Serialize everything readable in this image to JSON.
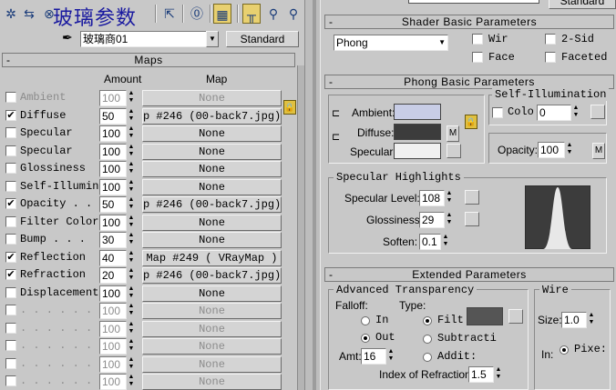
{
  "left": {
    "watermark_title": "玻璃参数",
    "material_name": "玻璃商01",
    "material_type_button": "Standard",
    "maps_rollout_title": "Maps",
    "col_amount": "Amount",
    "col_map": "Map",
    "rows": [
      {
        "label": "Ambient",
        "checked": false,
        "amount": "100",
        "map": "None",
        "dim": true
      },
      {
        "label": "Diffuse",
        "checked": true,
        "amount": "50",
        "map": "p #246 (00-back7.jpg)",
        "dim": false
      },
      {
        "label": "Specular",
        "checked": false,
        "amount": "100",
        "map": "None",
        "dim": false
      },
      {
        "label": "Specular",
        "checked": false,
        "amount": "100",
        "map": "None",
        "dim": false
      },
      {
        "label": "Glossiness",
        "checked": false,
        "amount": "100",
        "map": "None",
        "dim": false
      },
      {
        "label": "Self-Illumin",
        "checked": false,
        "amount": "100",
        "map": "None",
        "dim": false
      },
      {
        "label": "Opacity . .",
        "checked": true,
        "amount": "50",
        "map": "p #246 (00-back7.jpg)",
        "dim": false
      },
      {
        "label": "Filter Color",
        "checked": false,
        "amount": "100",
        "map": "None",
        "dim": false
      },
      {
        "label": "Bump . . .",
        "checked": false,
        "amount": "30",
        "map": "None",
        "dim": false
      },
      {
        "label": "Reflection",
        "checked": true,
        "amount": "40",
        "map": "Map #249  ( VRayMap )",
        "dim": false
      },
      {
        "label": "Refraction",
        "checked": true,
        "amount": "20",
        "map": "p #246 (00-back7.jpg)",
        "dim": false
      },
      {
        "label": "Displacement",
        "checked": false,
        "amount": "100",
        "map": "None",
        "dim": false
      },
      {
        "label": ". . . . . .",
        "checked": false,
        "amount": "100",
        "map": "None",
        "dim": true
      },
      {
        "label": ". . . . . .",
        "checked": false,
        "amount": "100",
        "map": "None",
        "dim": true
      },
      {
        "label": ". . . . . .",
        "checked": false,
        "amount": "100",
        "map": "None",
        "dim": true
      },
      {
        "label": ". . . . . .",
        "checked": false,
        "amount": "100",
        "map": "None",
        "dim": true
      },
      {
        "label": ". . . . . .",
        "checked": false,
        "amount": "100",
        "map": "None",
        "dim": true
      }
    ]
  },
  "right": {
    "top_button": "Standard",
    "shader_title": "Shader Basic Parameters",
    "shader_select": "Phong",
    "wire": "Wir",
    "two_sided": "2-Sid",
    "face": "Face",
    "faceted": "Faceted",
    "phong_title": "Phong Basic Parameters",
    "ambient_label": "Ambient:",
    "diffuse_label": "Diffuse:",
    "specular_label": "Specular:",
    "m_label": "M",
    "self_illum_title": "Self-Illumination",
    "color_label": "Colo",
    "color_value": "0",
    "opacity_label": "Opacity:",
    "opacity_value": "100",
    "spec_title": "Specular Highlights",
    "spec_level_label": "Specular Level:",
    "spec_level_value": "108",
    "gloss_label": "Glossiness:",
    "gloss_value": "29",
    "soften_label": "Soften:",
    "soften_value": "0.1",
    "ext_title": "Extended Parameters",
    "adv_title": "Advanced Transparency",
    "falloff_label": "Falloff:",
    "type_label": "Type:",
    "in_label": "In",
    "out_label": "Out",
    "filter_label": "Filt",
    "subtractive_label": "Subtracti",
    "additive_label": "Addit:",
    "amt_label": "Amt:",
    "amt_value": "16",
    "ior_label": "Index of Refraction:",
    "ior_value": "1.5",
    "wire_title": "Wire",
    "size_label": "Size:",
    "size_value": "1.0",
    "in2_label": "In:",
    "pixels_label": "Pixe:"
  },
  "colors": {
    "ambient": "#c8cde6",
    "diffuse": "#3c3c3c",
    "specular": "#f0f0f0",
    "filter": "#555555",
    "watermark": "#1a1aa0"
  }
}
